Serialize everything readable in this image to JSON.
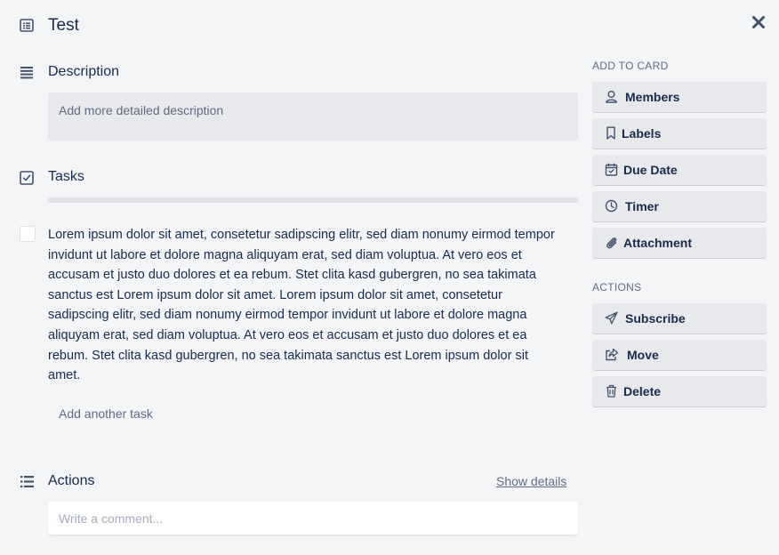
{
  "card": {
    "title": "Test"
  },
  "description": {
    "heading": "Description",
    "placeholder": "Add more detailed description"
  },
  "tasks": {
    "heading": "Tasks",
    "progress_percent": 0,
    "items": [
      {
        "checked": false,
        "text": "Lorem ipsum dolor sit amet, consetetur sadipscing elitr, sed diam nonumy eirmod tempor invidunt ut labore et dolore magna aliquyam erat, sed diam voluptua. At vero eos et accusam et justo duo dolores et ea rebum. Stet clita kasd gubergren, no sea takimata sanctus est Lorem ipsum dolor sit amet. Lorem ipsum dolor sit amet, consetetur sadipscing elitr, sed diam nonumy eirmod tempor invidunt ut labore et dolore magna aliquyam erat, sed diam voluptua. At vero eos et accusam et justo duo dolores et ea rebum. Stet clita kasd gubergren, no sea takimata sanctus est Lorem ipsum dolor sit amet."
      }
    ],
    "add_label": "Add another task"
  },
  "activity": {
    "heading": "Actions",
    "show_details": "Show details",
    "comment_placeholder": "Write a comment..."
  },
  "sidebar": {
    "add_to_card_label": "ADD TO CARD",
    "add_to_card": [
      {
        "label": "Members",
        "icon": "person-icon"
      },
      {
        "label": "Labels",
        "icon": "bookmark-icon"
      },
      {
        "label": "Due Date",
        "icon": "calendar-icon"
      },
      {
        "label": "Timer",
        "icon": "clock-icon"
      },
      {
        "label": "Attachment",
        "icon": "paperclip-icon"
      }
    ],
    "actions_label": "ACTIONS",
    "actions": [
      {
        "label": "Subscribe",
        "icon": "paper-plane-icon"
      },
      {
        "label": "Move",
        "icon": "share-icon"
      },
      {
        "label": "Delete",
        "icon": "trash-icon"
      }
    ]
  },
  "colors": {
    "background": "#f4f5f7",
    "button": "#e8e9ed",
    "text": "#172b4d",
    "muted": "#5e6c84"
  }
}
